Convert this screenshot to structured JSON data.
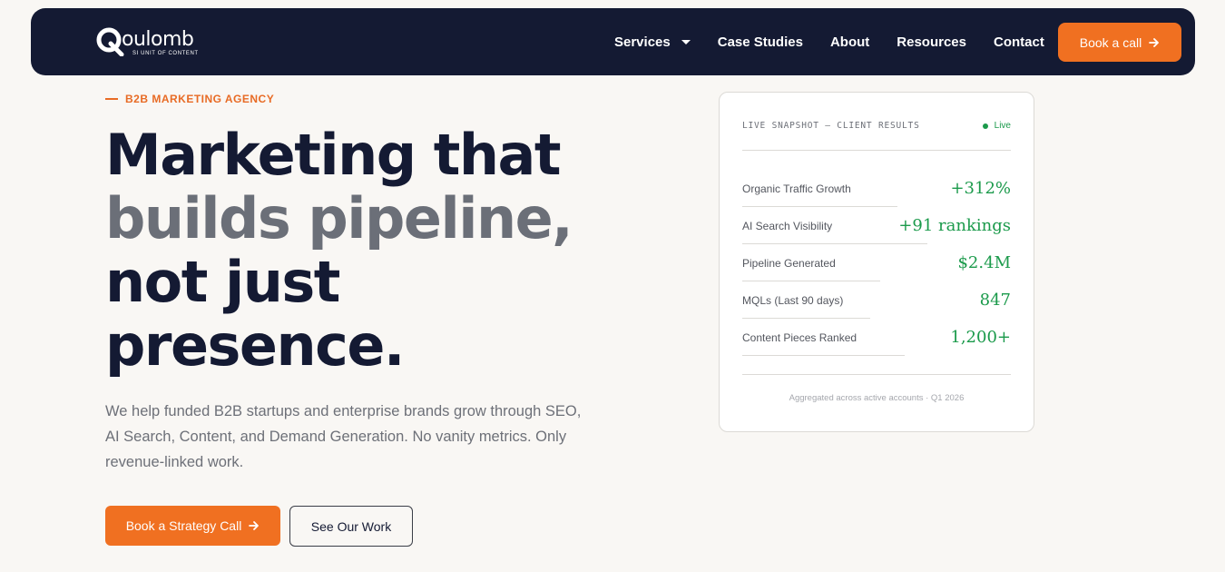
{
  "brand": {
    "name": "oulomb",
    "tagline": "SI UNIT OF CONTENT"
  },
  "nav": {
    "items": [
      {
        "label": "Services",
        "has_dropdown": true
      },
      {
        "label": "Case Studies"
      },
      {
        "label": "About"
      },
      {
        "label": "Resources"
      },
      {
        "label": "Contact"
      }
    ],
    "cta_label": "Book a call"
  },
  "hero": {
    "eyebrow": "B2B MARKETING AGENCY",
    "headline": {
      "line1": "Marketing that",
      "line2": "builds pipeline,",
      "line3": "not just",
      "line4": "presence."
    },
    "subtext": "We help funded B2B startups and enterprise brands grow through SEO, AI Search, Content, and Demand Generation. No vanity metrics. Only revenue-linked work.",
    "primary_cta": "Book a Strategy Call",
    "secondary_cta": "See Our Work"
  },
  "snapshot": {
    "title": "LIVE SNAPSHOT — CLIENT RESULTS",
    "status": "Live",
    "metrics": [
      {
        "label": "Organic Traffic Growth",
        "value": "+312%"
      },
      {
        "label": "AI Search Visibility",
        "value": "+91 rankings"
      },
      {
        "label": "Pipeline Generated",
        "value": "$2.4M"
      },
      {
        "label": "MQLs (Last 90 days)",
        "value": "847"
      },
      {
        "label": "Content Pieces Ranked",
        "value": "1,200+"
      }
    ],
    "footnote": "Aggregated across active accounts · Q1 2026"
  },
  "colors": {
    "navy": "#141a33",
    "accent_orange": "#f07021",
    "metric_green": "#1b9a4b",
    "background": "#f9f7f4"
  }
}
